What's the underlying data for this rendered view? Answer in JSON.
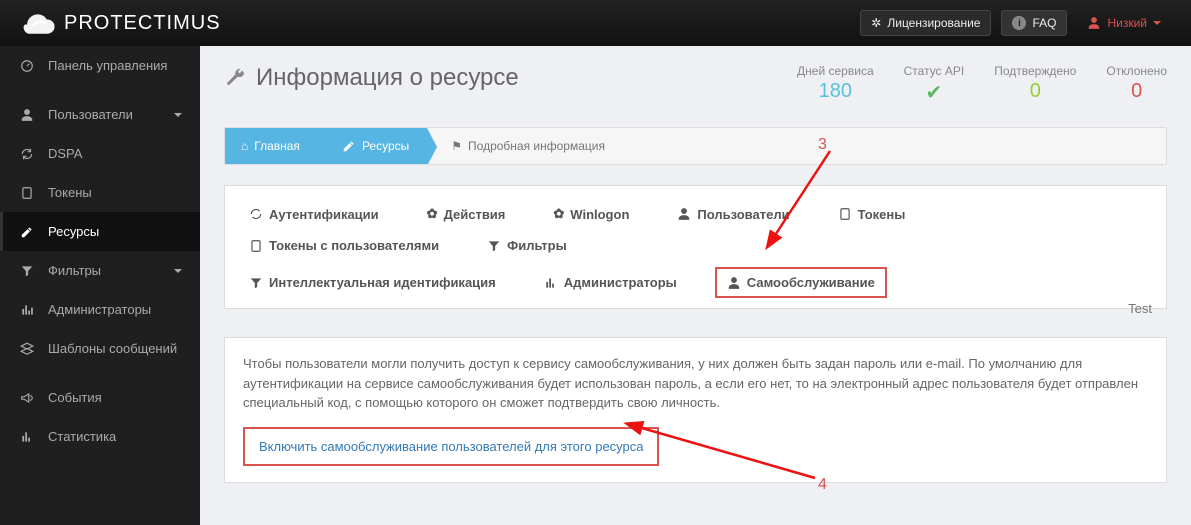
{
  "topbar": {
    "brand": "PROTECTIMUS",
    "licensing": "Лицензирование",
    "faq": "FAQ",
    "user": "Низкий"
  },
  "sidebar": {
    "dashboard": "Панель управления",
    "users": "Пользователи",
    "dspa": "DSPA",
    "tokens": "Токены",
    "resources": "Ресурсы",
    "filters": "Фильтры",
    "admins": "Администраторы",
    "templates": "Шаблоны сообщений",
    "events": "События",
    "stats": "Статистика"
  },
  "page": {
    "title": "Информация о ресурсе",
    "stats": {
      "days_label": "Дней сервиса",
      "days_value": "180",
      "status_label": "Статус API",
      "confirmed_label": "Подтверждено",
      "confirmed_value": "0",
      "rejected_label": "Отклонено",
      "rejected_value": "0"
    }
  },
  "crumb": {
    "home": "Главная",
    "resources": "Ресурсы",
    "detail": "Подробная информация"
  },
  "tabs": {
    "auth": "Аутентификации",
    "actions": "Действия",
    "winlogon": "Winlogon",
    "users": "Пользователи",
    "tokens": "Токены",
    "tokens_users": "Токены с пользователями",
    "filters": "Фильтры",
    "intel": "Интеллектуальная идентификация",
    "admins": "Администраторы",
    "self": "Самообслуживание",
    "resname": "Test"
  },
  "panel": {
    "text": "Чтобы пользователи могли получить доступ к сервису самообслуживания, у них должен быть задан пароль или e-mail. По умолчанию для аутентификации на сервисе самообслуживания будет использован пароль, а если его нет, то на электронный адрес пользователя будет отправлен специальный код, с помощью которого он сможет подтвердить свою личность.",
    "enable": "Включить самообслуживание пользователей для этого ресурса"
  },
  "ann": {
    "n3": "3",
    "n4": "4"
  }
}
